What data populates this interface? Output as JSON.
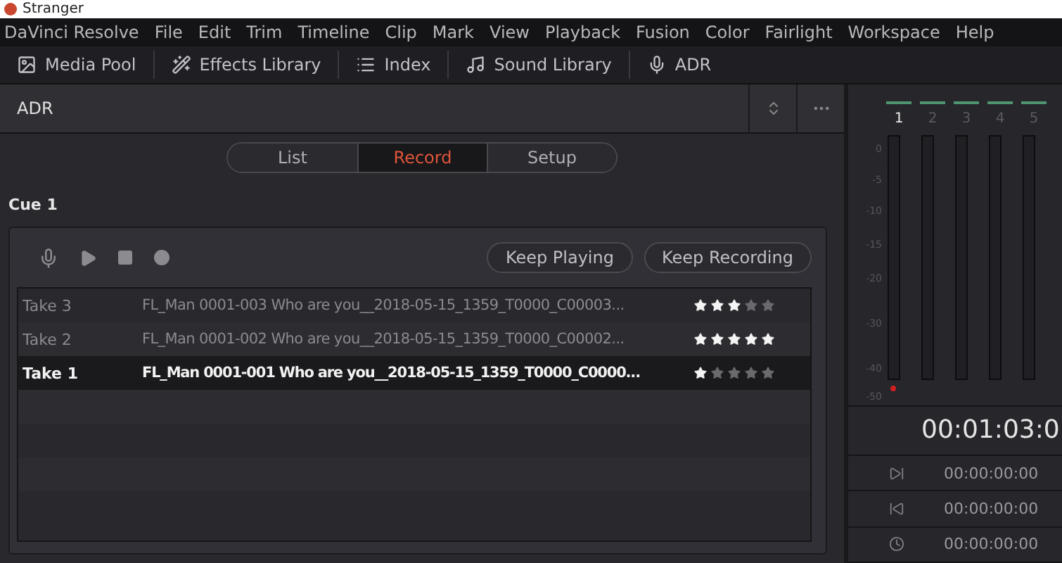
{
  "window": {
    "title": "Stranger"
  },
  "menu": [
    "DaVinci Resolve",
    "File",
    "Edit",
    "Trim",
    "Timeline",
    "Clip",
    "Mark",
    "View",
    "Playback",
    "Fusion",
    "Color",
    "Fairlight",
    "Workspace",
    "Help"
  ],
  "toolbar": [
    {
      "label": "Media Pool",
      "kind": "media"
    },
    {
      "label": "Effects Library",
      "kind": "effects"
    },
    {
      "label": "Index",
      "kind": "index"
    },
    {
      "label": "Sound Library",
      "kind": "sound"
    },
    {
      "label": "ADR",
      "kind": "adr"
    }
  ],
  "panel": {
    "title": "ADR",
    "tabs": [
      {
        "label": "List",
        "selected": false
      },
      {
        "label": "Record",
        "selected": true
      },
      {
        "label": "Setup",
        "selected": false
      }
    ],
    "cue": "Cue 1",
    "buttons": [
      "Keep Playing",
      "Keep Recording"
    ],
    "takes": [
      {
        "name": "Take 3",
        "file": "FL_Man 0001-003 Who are you__2018-05-15_1359_T0000_C00003...",
        "stars": 3,
        "selected": false
      },
      {
        "name": "Take 2",
        "file": "FL_Man 0001-002 Who are you__2018-05-15_1359_T0000_C00002...",
        "stars": 5,
        "selected": false
      },
      {
        "name": "Take 1",
        "file": "FL_Man 0001-001 Who are you__2018-05-15_1359_T0000_C0000...",
        "stars": 1,
        "selected": true
      }
    ]
  },
  "meters": {
    "channels": [
      {
        "label": "1",
        "selected": true,
        "armed": true
      },
      {
        "label": "2",
        "selected": false,
        "armed": false
      },
      {
        "label": "3",
        "selected": false,
        "armed": false
      },
      {
        "label": "4",
        "selected": false,
        "armed": false
      },
      {
        "label": "5",
        "selected": false,
        "armed": false
      }
    ],
    "scale": [
      "0",
      "-5",
      "-10",
      "-15",
      "-20",
      "-30",
      "-40",
      "-50"
    ]
  },
  "timecode": "00:01:03:0",
  "markers": [
    {
      "kind": "in",
      "time": "00:00:00:00"
    },
    {
      "kind": "out",
      "time": "00:00:00:00"
    },
    {
      "kind": "clock",
      "time": "00:00:00:00"
    }
  ]
}
